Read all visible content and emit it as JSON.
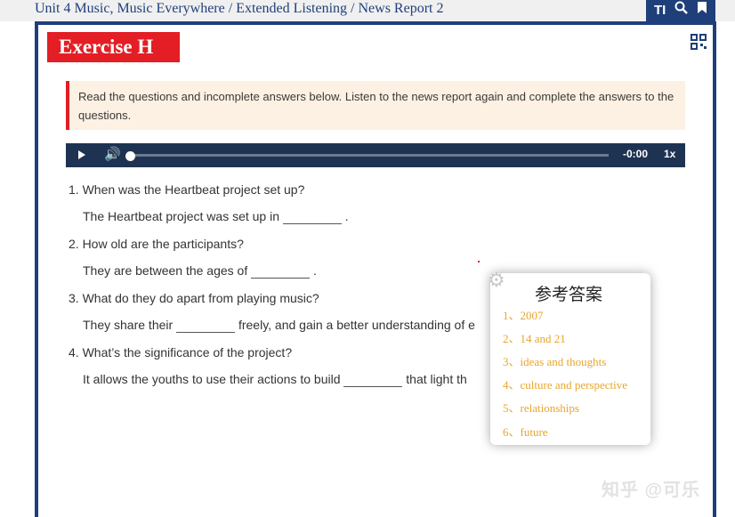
{
  "breadcrumb": "Unit 4 Music, Music Everywhere / Extended Listening / News Report 2",
  "toolbar": {
    "text_size_icon": "TI",
    "search_icon": "🔍",
    "bookmark_icon": "🔖"
  },
  "exercise_title": "Exercise H",
  "instructions": "Read the questions and incomplete answers below. Listen to the news report again and complete the answers to the questions.",
  "player": {
    "time": "-0:00",
    "speed": "1x",
    "progress": 0
  },
  "questions": [
    {
      "q": "1. When was the Heartbeat project set up?",
      "a_before": "The Heartbeat project was set up in",
      "a_after": "."
    },
    {
      "q": "2. How old are the participants?",
      "a_before": "They are between the ages of",
      "a_after": "."
    },
    {
      "q": "3. What do they do apart from playing music?",
      "a_before": "They share their",
      "a_after": "freely, and gain a better understanding of e"
    },
    {
      "q": "4. What’s the significance of the project?",
      "a_before": "It allows the youths to use their actions to build",
      "a_after": "that light th"
    }
  ],
  "answers_popup": {
    "title": "参考答案",
    "items": [
      "1、2007",
      "2、14 and 21",
      "3、ideas and thoughts",
      "4、culture and perspective",
      "5、relationships",
      "6、future"
    ]
  },
  "watermark": "知乎 @可乐",
  "colors": {
    "brand_blue": "#1f3f7a",
    "title_red": "#e31e24",
    "answer_orange": "#e8a52b",
    "player_bg": "#1e3352"
  }
}
